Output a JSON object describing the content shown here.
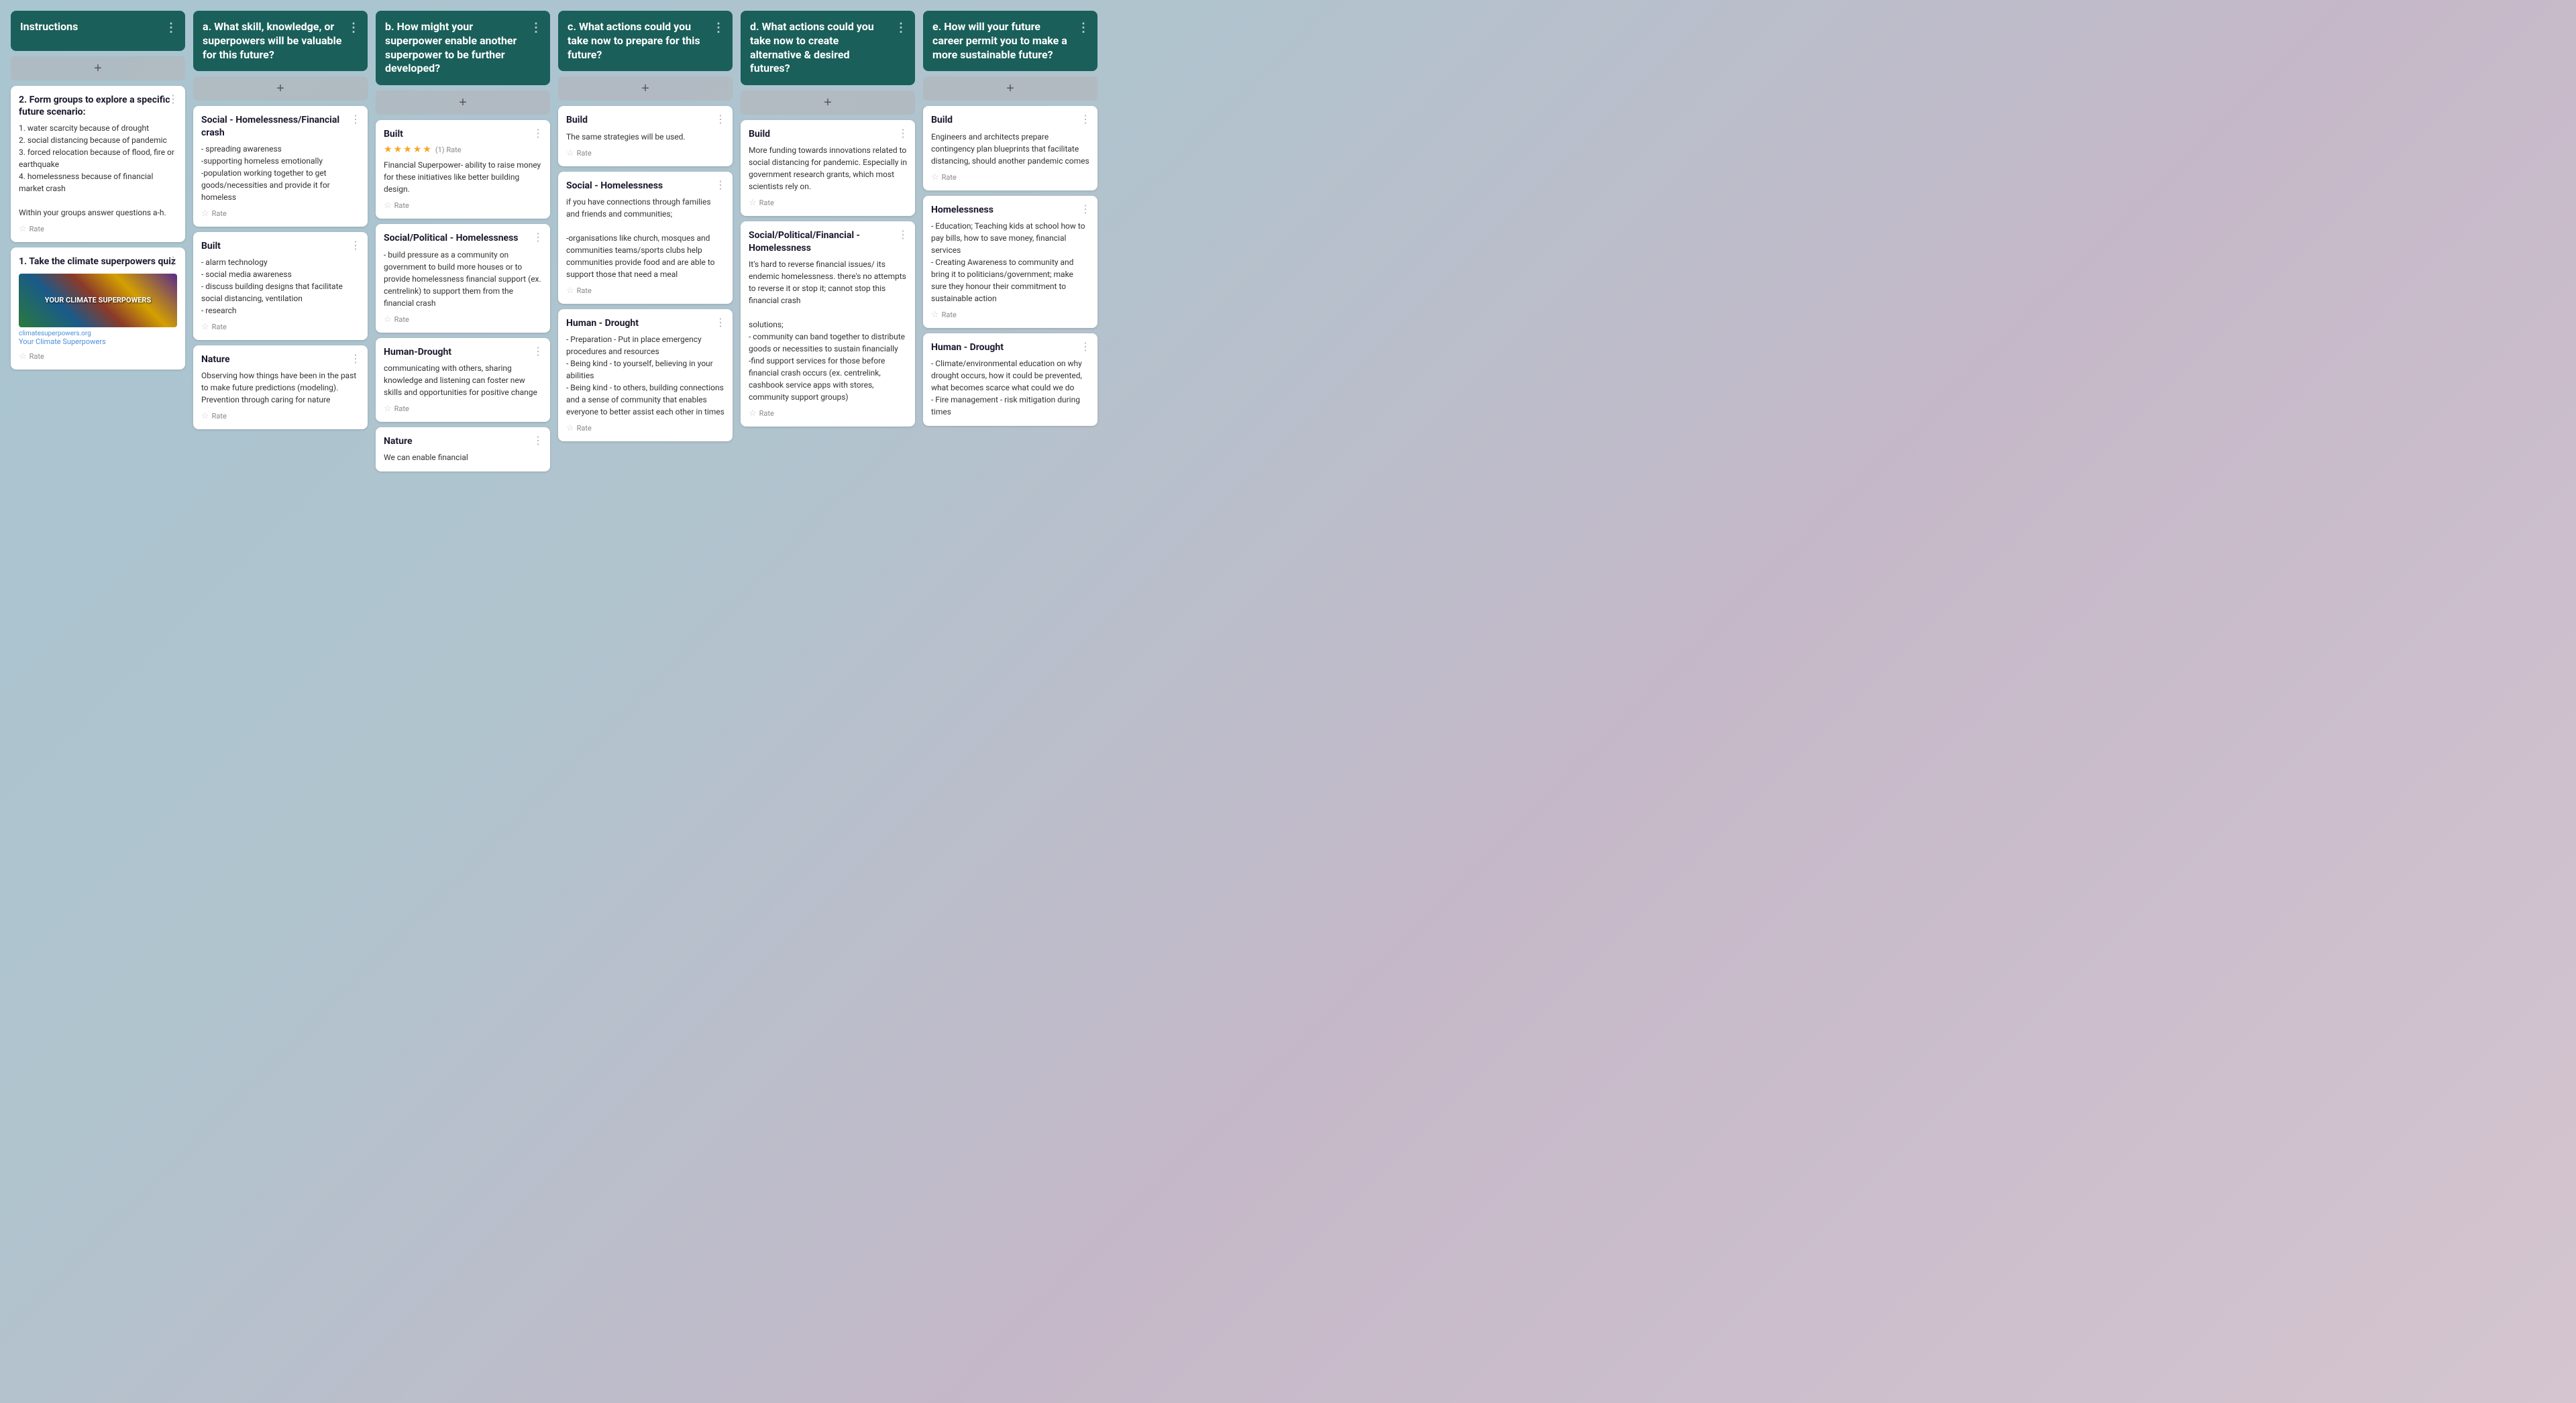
{
  "board": {
    "columns": [
      {
        "id": "instructions",
        "header": "Instructions",
        "isInstructions": true,
        "cards": [
          {
            "id": "card-form-groups",
            "title": "2. Form groups to explore a specific future scenario:",
            "body": "1. water scarcity because of drought\n2. social distancing because of pandemic\n3. forced relocation because of flood, fire or earthquake\n4. homelessness because of financial market crash\n\nWithin your groups answer questions a-h.",
            "hasRate": true,
            "hasStars": false,
            "starsCount": 0,
            "hasImage": false
          },
          {
            "id": "card-quiz",
            "title": "1. Take the climate superpowers quiz",
            "body": "",
            "hasRate": true,
            "hasStars": false,
            "hasImage": true,
            "imageText": "YOUR CLIMATE SUPERPOWERS",
            "imageUrl": "climatesuperpowers.org",
            "imageLinkLabel": "Your Climate Superpowers"
          }
        ]
      },
      {
        "id": "col-a",
        "header": "a. What skill, knowledge, or superpowers will be valuable for this future?",
        "cards": [
          {
            "id": "card-social-homelessness",
            "title": "Social - Homelessness/Financial crash",
            "body": "- spreading awareness\n-supporting homeless emotionally\n-population working together to get goods/necessities and provide it for homeless",
            "hasRate": true,
            "hasStars": false
          },
          {
            "id": "card-built-a",
            "title": "Built",
            "body": "- alarm technology\n- social media awareness\n- discuss building designs that facilitate social distancing, ventilation\n- research",
            "hasRate": true,
            "hasStars": false
          },
          {
            "id": "card-nature-a",
            "title": "Nature",
            "body": "Observing how things have been in the past to make future predictions (modeling). Prevention through caring for nature",
            "hasRate": true,
            "hasStars": false
          }
        ]
      },
      {
        "id": "col-b",
        "header": "b. How might your superpower enable another superpower to be further developed?",
        "cards": [
          {
            "id": "card-built-b",
            "title": "Built",
            "body": "Financial Superpower- ability to raise money for these initiatives like better building design.",
            "hasRate": true,
            "hasStars": true,
            "starsCount": 5,
            "rateLabel": "(1) Rate"
          },
          {
            "id": "card-socialpolitical-b",
            "title": "Social/Political - Homelessness",
            "body": "- build pressure as a community on government to build more houses or to provide homelessness financial support (ex. centrelink) to support them from the financial crash",
            "hasRate": true,
            "hasStars": false
          },
          {
            "id": "card-human-drought-b",
            "title": "Human-Drought",
            "body": "communicating with others, sharing knowledge and listening can foster new skills and opportunities for positive change",
            "hasRate": true,
            "hasStars": false
          },
          {
            "id": "card-nature-b",
            "title": "Nature",
            "body": "We can enable financial",
            "hasRate": false,
            "hasStars": false,
            "truncated": true
          }
        ]
      },
      {
        "id": "col-c",
        "header": "c. What actions could you take now to prepare for this future?",
        "cards": [
          {
            "id": "card-build-c",
            "title": "Build",
            "body": "The same strategies will be used.",
            "hasRate": true,
            "hasStars": false
          },
          {
            "id": "card-social-homelessness-c",
            "title": "Social - Homelessness",
            "body": "if you have connections through families and friends and communities;\n\n-organisations like church, mosques and communities teams/sports clubs help communities provide food and are able to support those that need a meal",
            "hasRate": true,
            "hasStars": false
          },
          {
            "id": "card-human-drought-c",
            "title": "Human - Drought",
            "body": "- Preparation - Put in place emergency procedures and resources\n- Being kind - to yourself, believing in your abilities\n- Being kind - to others, building connections and a sense of community that enables everyone to better assist each other in times",
            "hasRate": true,
            "hasStars": false
          }
        ]
      },
      {
        "id": "col-d",
        "header": "d. What actions could you take now to create alternative & desired futures?",
        "cards": [
          {
            "id": "card-build-d",
            "title": "Build",
            "body": "More funding towards innovations related to social distancing for pandemic. Especially in government research grants, which most scientists rely on.",
            "hasRate": true,
            "hasStars": false
          },
          {
            "id": "card-socialpolitical-financial-d",
            "title": "Social/Political/Financial - Homelessness",
            "body": "It's hard to reverse financial issues/ its endemic homelessness. there's no attempts to reverse it or stop it; cannot stop this financial crash\n\nsolutions;\n- community can band together to distribute goods or necessities to sustain financially\n-find support services for those before financial crash occurs (ex. centrelink, cashbook service apps with stores, community support groups)",
            "hasRate": true,
            "hasStars": false
          }
        ]
      },
      {
        "id": "col-e",
        "header": "e. How will your future career permit you to make a more sustainable future?",
        "cards": [
          {
            "id": "card-build-e",
            "title": "Build",
            "body": "Engineers and architects prepare contingency plan blueprints that facilitate distancing, should another pandemic comes",
            "hasRate": true,
            "hasStars": false,
            "truncated": true
          },
          {
            "id": "card-homelessness-e",
            "title": "Homelessness",
            "body": "- Education; Teaching kids at school how to pay bills, how to save money, financial services\n- Creating Awareness to community and bring it to politicians/government; make sure they honour their commitment to sustainable action",
            "hasRate": true,
            "hasStars": false
          },
          {
            "id": "card-human-drought-e",
            "title": "Human - Drought",
            "body": "- Climate/environmental education on why drought occurs, how it could be prevented, what becomes scarce what could we do\n- Fire management - risk mitigation during times",
            "hasRate": false,
            "hasStars": false,
            "truncated": true
          }
        ]
      }
    ],
    "addButtonLabel": "+",
    "rateLabel": "Rate",
    "menuIcon": "⋮"
  }
}
